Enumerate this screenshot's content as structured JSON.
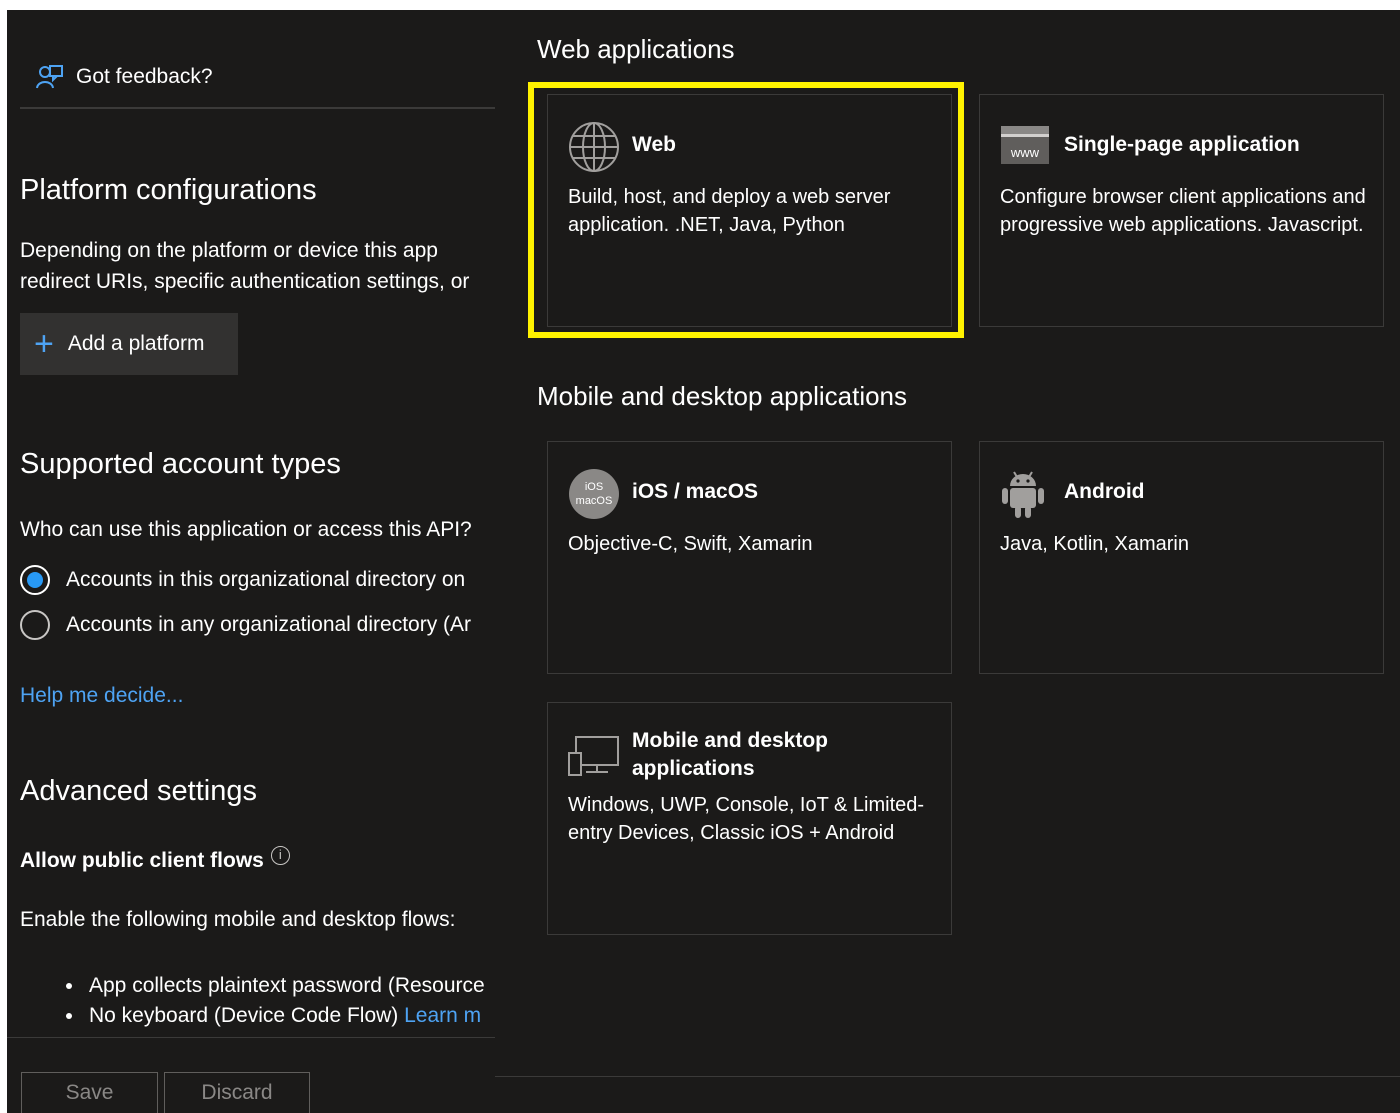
{
  "left": {
    "feedback_label": "Got feedback?",
    "platform_title": "Platform configurations",
    "platform_desc_line1": "Depending on the platform or device this app",
    "platform_desc_line2": "redirect URIs, specific authentication settings, or",
    "add_platform_label": "Add a platform",
    "account_types_title": "Supported account types",
    "account_question": "Who can use this application or access this API?",
    "radio_options": [
      {
        "label": "Accounts in this organizational directory on",
        "checked": true
      },
      {
        "label": "Accounts in any organizational directory (Ar",
        "checked": false
      }
    ],
    "help_link": "Help me decide...",
    "advanced_title": "Advanced settings",
    "public_flows_label": "Allow public client flows",
    "info_glyph": "i",
    "flows_text": "Enable the following mobile and desktop flows:",
    "bullets": [
      {
        "text": "App collects plaintext password (Resource",
        "link": ""
      },
      {
        "text": "No keyboard (Device Code Flow) ",
        "link": "Learn m"
      }
    ],
    "save_label": "Save",
    "discard_label": "Discard"
  },
  "right": {
    "web_group_title": "Web applications",
    "mobile_group_title": "Mobile and desktop applications",
    "tiles": [
      {
        "title": "Web",
        "desc": "Build, host, and deploy a web server application. .NET, Java, Python",
        "icon": "globe-icon"
      },
      {
        "title": "Single-page application",
        "desc": "Configure browser client applications and progressive web applications. Javascript.",
        "icon": "www-icon",
        "icon_text": "www"
      },
      {
        "title": "iOS / macOS",
        "desc": "Objective-C, Swift, Xamarin",
        "icon": "apple-ios-icon",
        "icon_text_top": "iOS",
        "icon_text_bottom": "macOS"
      },
      {
        "title": "Android",
        "desc": "Java, Kotlin, Xamarin",
        "icon": "android-icon"
      },
      {
        "title": "Mobile and desktop applications",
        "desc": "Windows, UWP, Console, IoT & Limited-entry Devices, Classic iOS + Android",
        "icon": "desktop-icon"
      }
    ]
  },
  "colors": {
    "panel_bg": "#1b1a19",
    "accent_blue": "#4ea3f3",
    "highlight": "#fff200"
  }
}
